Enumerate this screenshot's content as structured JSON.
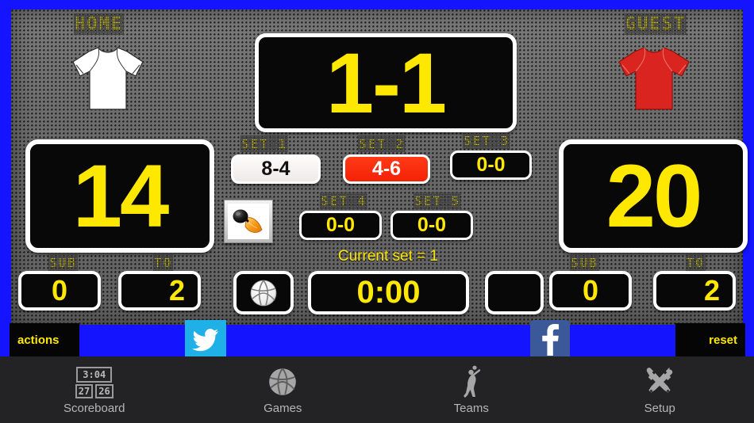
{
  "app": {
    "accent_blue": "#1414ff",
    "led_yellow": "#ffe800",
    "panel_black": "#080808"
  },
  "scoreboard": {
    "home": {
      "label": "HOME",
      "jersey_color": "#ffffff",
      "points": "14",
      "sub_label": "SUB",
      "sub_value": "0",
      "to_label": "TO",
      "to_value": "2"
    },
    "guest": {
      "label": "GUEST",
      "jersey_color": "#d9241f",
      "points": "20",
      "sub_label": "SUB",
      "sub_value": "0",
      "to_label": "TO",
      "to_value": "2"
    },
    "match_score": "1-1",
    "sets": [
      {
        "label": "SET 1",
        "score": "8-4",
        "state": "won"
      },
      {
        "label": "SET 2",
        "score": "4-6",
        "state": "lost"
      },
      {
        "label": "SET 3",
        "score": "0-0",
        "state": "normal"
      },
      {
        "label": "SET 4",
        "score": "0-0",
        "state": "normal"
      },
      {
        "label": "SET 5",
        "score": "0-0",
        "state": "normal"
      }
    ],
    "current_set_text": "Current set = 1",
    "timer": "0:00",
    "horn_icon": "air-horn-icon",
    "ball_icon": "volleyball-icon",
    "blank_box": ""
  },
  "footer": {
    "actions_label": "actions",
    "reset_label": "reset",
    "twitter_icon": "twitter-bird-icon",
    "facebook_icon": "facebook-f-icon",
    "twitter_color": "#1fb0e8",
    "facebook_color": "#3b5998"
  },
  "tabbar": {
    "items": [
      {
        "label": "Scoreboard",
        "icon": "scoreboard-icon",
        "active": true
      },
      {
        "label": "Games",
        "icon": "volleyball-icon",
        "active": false
      },
      {
        "label": "Teams",
        "icon": "player-spike-icon",
        "active": false
      },
      {
        "label": "Setup",
        "icon": "tools-icon",
        "active": false
      }
    ],
    "scoreboard_icon_time": "3:04",
    "scoreboard_icon_home": "27",
    "scoreboard_icon_guest": "26"
  }
}
